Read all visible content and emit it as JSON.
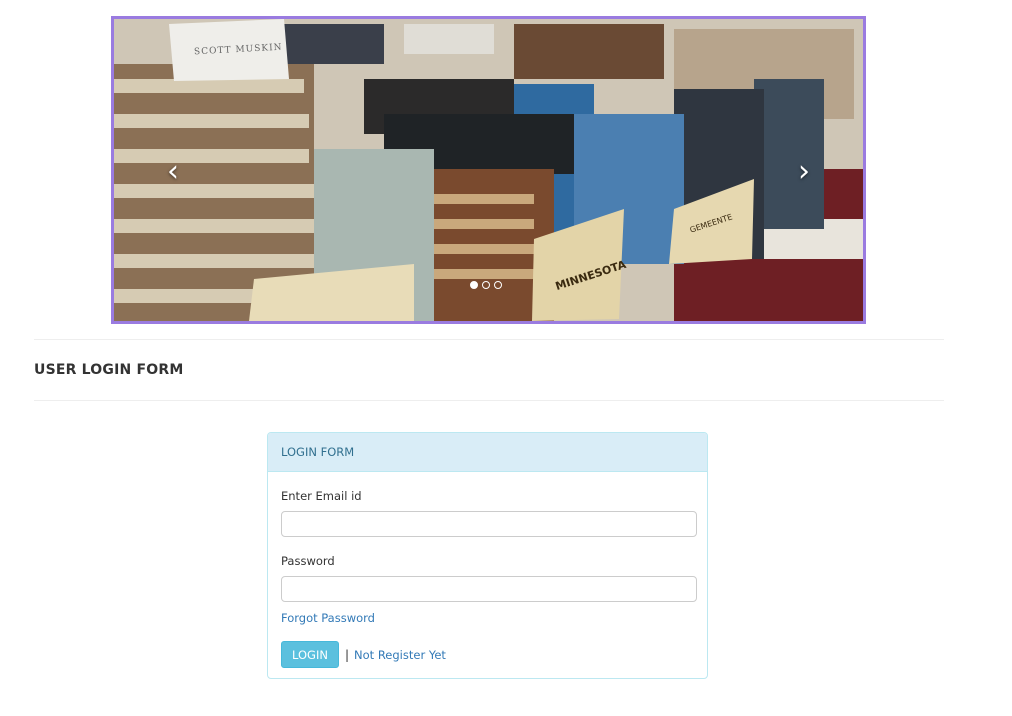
{
  "carousel": {
    "prev_icon": "chevron-left-icon",
    "next_icon": "chevron-right-icon",
    "prev_glyph": "‹",
    "next_glyph": "›",
    "slide_count": 3,
    "active_slide": 1,
    "image_texts": {
      "sign_top": "SCOTT MUSKIN",
      "sign_center": "MINNESOTA",
      "sign_right": "GEMEENTE"
    }
  },
  "section": {
    "title": "USER LOGIN FORM"
  },
  "login_panel": {
    "heading": "LOGIN FORM",
    "email_label": "Enter Email id",
    "email_value": "",
    "email_placeholder": "",
    "password_label": "Password",
    "password_value": "",
    "password_placeholder": "",
    "forgot_link": "Forgot Password",
    "login_button": "LOGIN",
    "separator": "|",
    "register_link": "Not Register Yet"
  },
  "colors": {
    "carousel_border": "#9a7be0",
    "panel_heading_bg": "#d9edf7",
    "panel_border": "#bce8f1",
    "button_bg": "#5bc0de",
    "link": "#337ab7"
  }
}
